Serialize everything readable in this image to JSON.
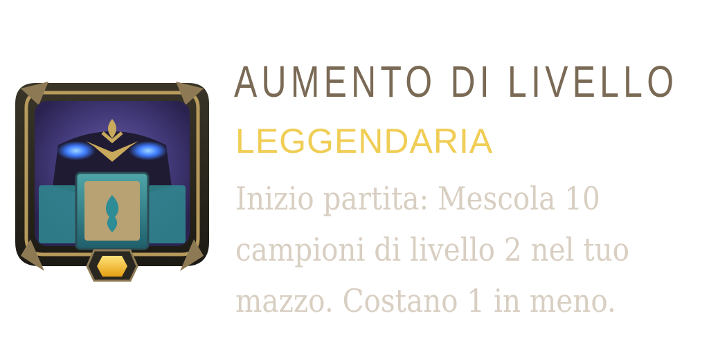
{
  "card": {
    "title": "AUMENTO DI LIVELLO",
    "rarity": "LEGGENDARIA",
    "description_lines": [
      "Inizio partita: Mescola 10",
      "campioni di livello 2 nel tuo",
      "mazzo. Costano 1 in meno."
    ],
    "icon": "legendary-augment-emblem-icon"
  },
  "colors": {
    "title": "#7a6a55",
    "rarity": "#f0cd55",
    "description": "#d8cfc2",
    "gem": "#f7c531"
  }
}
